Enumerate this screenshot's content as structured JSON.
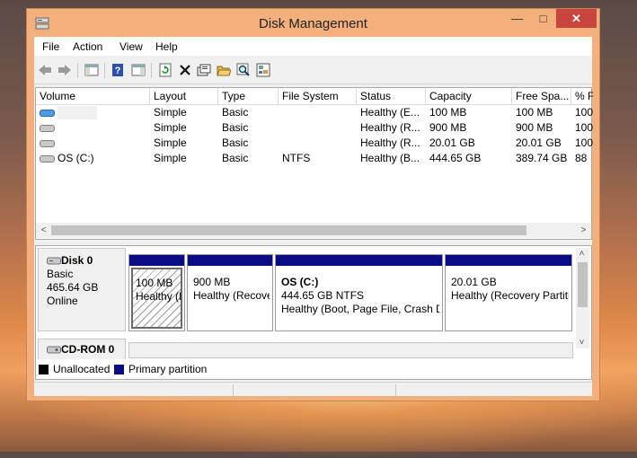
{
  "window": {
    "title": "Disk Management",
    "minimize_glyph": "—",
    "maximize_glyph": "□",
    "close_glyph": "✕"
  },
  "menu": [
    "File",
    "Action",
    "View",
    "Help"
  ],
  "toolbar": [
    "back-icon",
    "forward-icon",
    "show-hide-console-tree-icon",
    "help-icon",
    "properties-pane-icon",
    "refresh-icon",
    "delete-icon",
    "properties-icon",
    "open-icon",
    "explore-icon",
    "rescan-disks-icon"
  ],
  "volume_list": {
    "columns": [
      "Volume",
      "Layout",
      "Type",
      "File System",
      "Status",
      "Capacity",
      "Free Spa...",
      "% F"
    ],
    "rows": [
      [
        "",
        "Simple",
        "Basic",
        "",
        "Healthy (E...",
        "100 MB",
        "100 MB",
        "100"
      ],
      [
        "",
        "Simple",
        "Basic",
        "",
        "Healthy (R...",
        "900 MB",
        "900 MB",
        "100"
      ],
      [
        "",
        "Simple",
        "Basic",
        "",
        "Healthy (R...",
        "20.01 GB",
        "20.01 GB",
        "100"
      ],
      [
        "OS (C:)",
        "Simple",
        "Basic",
        "NTFS",
        "Healthy (B...",
        "444.65 GB",
        "389.74 GB",
        "88"
      ]
    ],
    "left_arrow": "<",
    "right_arrow": ">"
  },
  "disk0": {
    "name": "Disk 0",
    "type": "Basic",
    "size": "465.64 GB",
    "state": "Online",
    "partitions": [
      {
        "name": "",
        "size": "100 MB",
        "status": "Healthy (E"
      },
      {
        "name": "",
        "size": "900 MB",
        "status": "Healthy (Recove"
      },
      {
        "name": "OS  (C:)",
        "size": "444.65 GB NTFS",
        "status": "Healthy (Boot, Page File, Crash D"
      },
      {
        "name": "",
        "size": "20.01 GB",
        "status": "Healthy (Recovery Partiti"
      }
    ]
  },
  "cdrom": {
    "name": "CD-ROM 0"
  },
  "scroll": {
    "down_arrow": "˅"
  },
  "legend": [
    {
      "label": "Unallocated",
      "color": "#000000"
    },
    {
      "label": "Primary partition",
      "color": "#0a0a84"
    }
  ],
  "colors": {
    "partition_header": "#0a0a84",
    "close_button": "#c7453c",
    "frame": "#f4b07c"
  }
}
